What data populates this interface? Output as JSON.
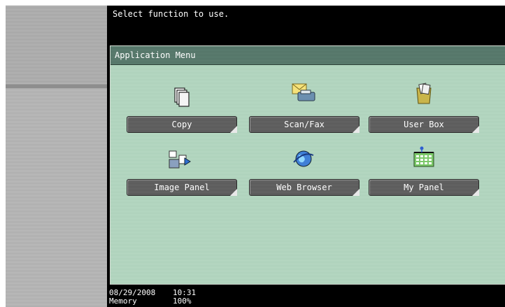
{
  "message": "Select function to use.",
  "app_menu": {
    "title": "Application Menu",
    "items": [
      {
        "label": "Copy",
        "icon": "copy-icon"
      },
      {
        "label": "Scan/Fax",
        "icon": "scan-fax-icon"
      },
      {
        "label": "User Box",
        "icon": "user-box-icon"
      },
      {
        "label": "Image Panel",
        "icon": "image-panel-icon"
      },
      {
        "label": "Web Browser",
        "icon": "web-browser-icon"
      },
      {
        "label": "My Panel",
        "icon": "my-panel-icon"
      }
    ]
  },
  "status": {
    "date": "08/29/2008",
    "time": "10:31",
    "memory_label": "Memory",
    "memory_value": "100%"
  },
  "colors": {
    "frame_bg": "#bcdcc7",
    "header_bg": "#5f8274",
    "button_bg": "#6a6a6a"
  }
}
